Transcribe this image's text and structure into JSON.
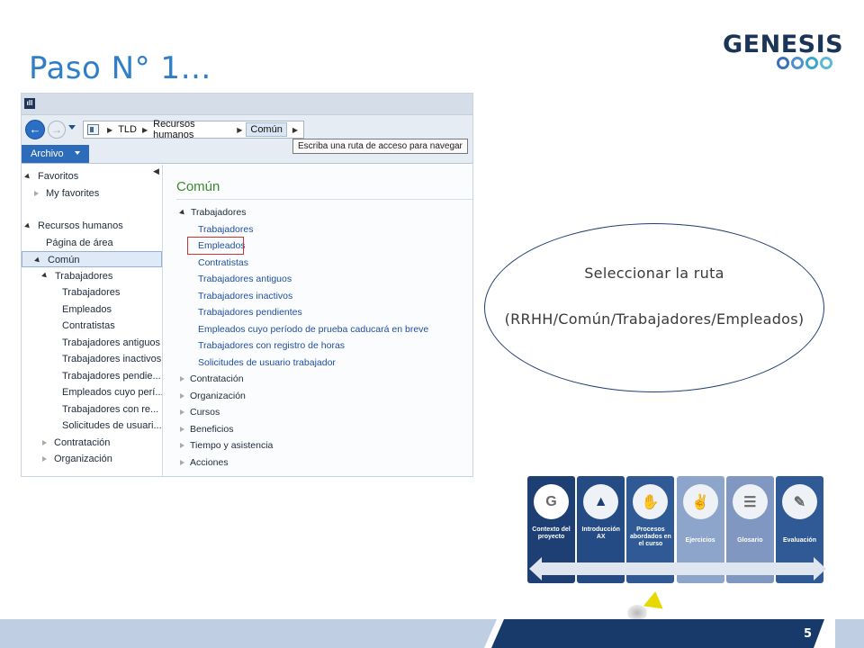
{
  "slide": {
    "title": "Paso N° 1…",
    "page_number": "5"
  },
  "logo": {
    "text": "GENESIS"
  },
  "ax": {
    "address": {
      "segments": [
        "TLD",
        "Recursos humanos",
        "Común"
      ]
    },
    "archivo_label": "Archivo",
    "tooltip": "Escriba una ruta de acceso para navegar",
    "nav_tree": {
      "items": [
        {
          "label": "Favoritos",
          "state": "expanded",
          "indent": 0
        },
        {
          "label": "My favorites",
          "state": "collapsed",
          "indent": 1
        },
        {
          "label": "Recursos humanos",
          "state": "expanded",
          "indent": 0
        },
        {
          "label": "Página de área",
          "state": "none",
          "indent": 1
        },
        {
          "label": "Común",
          "state": "expanded",
          "indent": 1,
          "selected": true
        },
        {
          "label": "Trabajadores",
          "state": "expanded",
          "indent": 2
        },
        {
          "label": "Trabajadores",
          "state": "none",
          "indent": 3
        },
        {
          "label": "Empleados",
          "state": "none",
          "indent": 3
        },
        {
          "label": "Contratistas",
          "state": "none",
          "indent": 3
        },
        {
          "label": "Trabajadores antiguos",
          "state": "none",
          "indent": 3
        },
        {
          "label": "Trabajadores inactivos",
          "state": "none",
          "indent": 3
        },
        {
          "label": "Trabajadores pendie...",
          "state": "none",
          "indent": 3
        },
        {
          "label": "Empleados cuyo perí...",
          "state": "none",
          "indent": 3
        },
        {
          "label": "Trabajadores con re...",
          "state": "none",
          "indent": 3
        },
        {
          "label": "Solicitudes de usuari...",
          "state": "none",
          "indent": 3
        },
        {
          "label": "Contratación",
          "state": "collapsed",
          "indent": 2
        },
        {
          "label": "Organización",
          "state": "collapsed",
          "indent": 2
        }
      ]
    },
    "content": {
      "title": "Común",
      "items": [
        {
          "label": "Trabajadores",
          "kind": "group",
          "state": "expanded"
        },
        {
          "label": "Trabajadores",
          "kind": "link"
        },
        {
          "label": "Empleados",
          "kind": "link",
          "highlighted": true
        },
        {
          "label": "Contratistas",
          "kind": "link"
        },
        {
          "label": "Trabajadores antiguos",
          "kind": "link"
        },
        {
          "label": "Trabajadores inactivos",
          "kind": "link"
        },
        {
          "label": "Trabajadores pendientes",
          "kind": "link"
        },
        {
          "label": "Empleados cuyo período de prueba caducará en breve",
          "kind": "link"
        },
        {
          "label": "Trabajadores con registro de horas",
          "kind": "link"
        },
        {
          "label": "Solicitudes de usuario trabajador",
          "kind": "link"
        },
        {
          "label": "Contratación",
          "kind": "group",
          "state": "collapsed"
        },
        {
          "label": "Organización",
          "kind": "group",
          "state": "collapsed"
        },
        {
          "label": "Cursos",
          "kind": "group",
          "state": "collapsed"
        },
        {
          "label": "Beneficios",
          "kind": "group",
          "state": "collapsed"
        },
        {
          "label": "Tiempo y asistencia",
          "kind": "group",
          "state": "collapsed"
        },
        {
          "label": "Acciones",
          "kind": "group",
          "state": "collapsed"
        }
      ]
    }
  },
  "callout": {
    "line1": "Seleccionar la ruta",
    "line2": "(RRHH/Común/Trabajadores/Empleados)"
  },
  "roadmap": {
    "cards": [
      {
        "label": "Contexto del proyecto",
        "icon": "genesis-logo-icon",
        "color": "#1d3f73"
      },
      {
        "label": "Introducción AX",
        "icon": "dynamics-ax-icon",
        "color": "#244b84"
      },
      {
        "label": "Procesos abordados en el curso",
        "icon": "handshake-icon",
        "color": "#2f5a96"
      },
      {
        "label": "Ejercicios",
        "icon": "hands-icon",
        "color": "#8da4cb"
      },
      {
        "label": "Glosario",
        "icon": "book-icon",
        "color": "#7f97c1"
      },
      {
        "label": "Evaluación",
        "icon": "pen-icon",
        "color": "#2f5a96"
      }
    ]
  },
  "colors": {
    "title": "#2f7fc8",
    "link": "#1d4e9e",
    "content_title": "#3a8a2a",
    "highlight": "#d43030",
    "footer": "#173a6b"
  }
}
